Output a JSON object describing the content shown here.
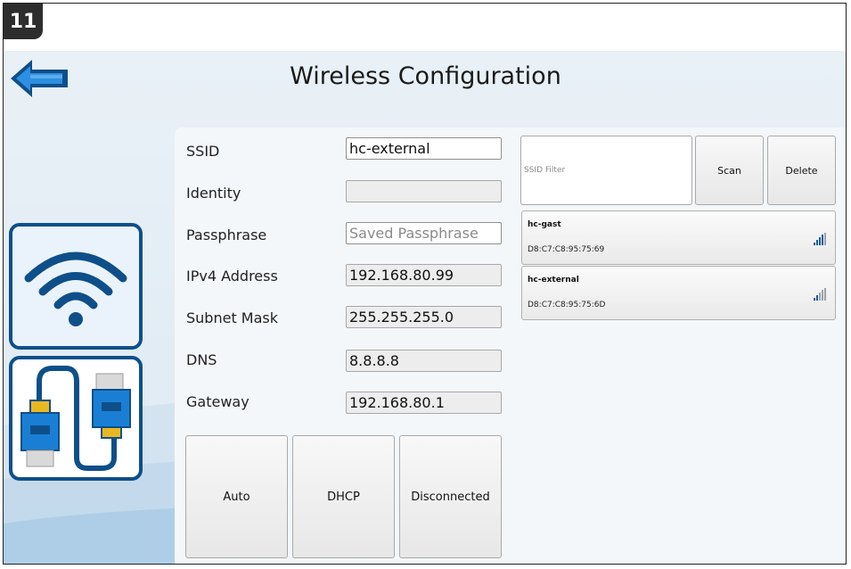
{
  "step_badge": "11",
  "title": "Wireless Configuration",
  "form": {
    "ssid": {
      "label": "SSID",
      "value": "hc-external"
    },
    "identity": {
      "label": "Identity",
      "value": ""
    },
    "passphrase": {
      "label": "Passphrase",
      "placeholder": "Saved Passphrase"
    },
    "ipv4": {
      "label": "IPv4 Address",
      "value": "192.168.80.99"
    },
    "subnet": {
      "label": "Subnet Mask",
      "value": "255.255.255.0"
    },
    "dns": {
      "label": "DNS",
      "value": "8.8.8.8"
    },
    "gateway": {
      "label": "Gateway",
      "value": "192.168.80.1"
    }
  },
  "buttons": {
    "auto": "Auto",
    "dhcp": "DHCP",
    "status": "Disconnected",
    "scan": "Scan",
    "delete": "Delete"
  },
  "filter": {
    "placeholder": "SSID Filter"
  },
  "networks": [
    {
      "name": "hc-gast",
      "mac": "D8:C7:C8:95:75:69",
      "signal_icon": "signal-strength-icon"
    },
    {
      "name": "hc-external",
      "mac": "D8:C7:C8:95:75:6D",
      "signal_icon": "signal-strength-icon"
    }
  ],
  "icons": {
    "back": "back-arrow-icon",
    "wifi": "wifi-icon",
    "ethernet": "ethernet-cable-icon"
  },
  "colors": {
    "accent": "#1a7fd4",
    "dark_blue": "#0e4f8a",
    "connector_yellow": "#e8b820"
  }
}
